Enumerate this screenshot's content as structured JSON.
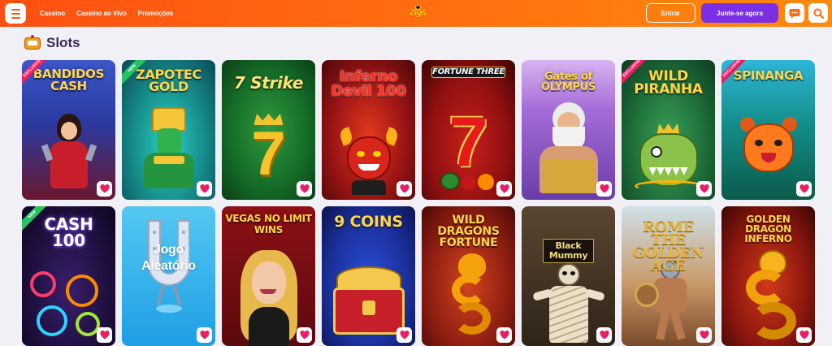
{
  "header": {
    "nav": [
      "Cassino",
      "Cassino ao Vivo",
      "Promoções"
    ],
    "logo_text": "Zigs",
    "login_label": "Entrar",
    "join_label": "Junte-se agora"
  },
  "section": {
    "title": "Slots",
    "icon": "slot-machine-icon"
  },
  "colors": {
    "brand_orange": "#ff6a10",
    "join_purple": "#7b2fe4",
    "favorite_pink": "#e91e63"
  },
  "games": [
    {
      "title": "BANDIDOS CASH",
      "badge": "EXCLUSIVE",
      "icon": "heart-icon"
    },
    {
      "title": "ZAPOTEC GOLD",
      "badge": "NEW",
      "icon": "heart-icon"
    },
    {
      "title": "7 Strike",
      "badge": "",
      "icon": "heart-icon"
    },
    {
      "title": "Inferno Devil 100",
      "badge": "",
      "icon": "heart-icon"
    },
    {
      "title": "FORTUNE THREE",
      "badge": "",
      "icon": "heart-icon"
    },
    {
      "title": "Gates of OLYMPUS",
      "badge": "",
      "icon": "heart-icon"
    },
    {
      "title": "WILD PIRANHA",
      "badge": "EXCLUSIVE",
      "icon": "heart-icon"
    },
    {
      "title": "SPINANGA",
      "badge": "EXCLUSIVE",
      "icon": "heart-icon"
    },
    {
      "title": "CASH 100",
      "badge": "NEW",
      "icon": "heart-icon"
    },
    {
      "title": "Jogo Aleatório",
      "badge": "",
      "icon": "horseshoe-icon"
    },
    {
      "title": "VEGAS NO LIMIT WINS",
      "badge": "",
      "icon": "heart-icon"
    },
    {
      "title": "9 COINS",
      "badge": "",
      "icon": "heart-icon"
    },
    {
      "title": "WILD DRAGONS FORTUNE",
      "badge": "",
      "icon": "heart-icon"
    },
    {
      "title": "Black Mummy",
      "badge": "",
      "icon": "heart-icon"
    },
    {
      "title": "ROME THE GOLDEN AGE",
      "badge": "",
      "icon": "heart-icon"
    },
    {
      "title": "GOLDEN DRAGON INFERNO",
      "badge": "",
      "icon": "heart-icon"
    }
  ]
}
